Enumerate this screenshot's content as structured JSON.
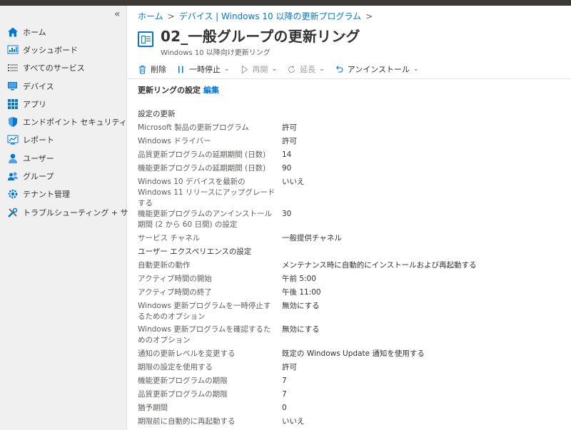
{
  "sidebar": {
    "collapse_glyph": "«",
    "items": [
      {
        "label": "ホーム",
        "icon": "home-icon"
      },
      {
        "label": "ダッシュボード",
        "icon": "dashboard-icon"
      },
      {
        "label": "すべてのサービス",
        "icon": "list-icon"
      },
      {
        "label": "デバイス",
        "icon": "devices-icon"
      },
      {
        "label": "アプリ",
        "icon": "apps-icon"
      },
      {
        "label": "エンドポイント セキュリティ",
        "icon": "shield-icon"
      },
      {
        "label": "レポート",
        "icon": "reports-icon"
      },
      {
        "label": "ユーザー",
        "icon": "user-icon"
      },
      {
        "label": "グループ",
        "icon": "group-icon"
      },
      {
        "label": "テナント管理",
        "icon": "tenant-gear-icon"
      },
      {
        "label": "トラブルシューティング + サポート",
        "icon": "wrench-icon"
      }
    ]
  },
  "breadcrumb": {
    "home": "ホーム",
    "devices": "デバイス | Windows 10 以降の更新プログラム"
  },
  "header": {
    "title": "02_一般グループの更新リング",
    "subtitle": "Windows 10 以降向け更新リング",
    "more": "···"
  },
  "toolbar": {
    "delete": "削除",
    "pause": "一時停止",
    "resume": "再開",
    "extend": "延長",
    "uninstall": "アンインストール"
  },
  "section": {
    "title": "更新リングの設定",
    "edit": "編集"
  },
  "settings": [
    {
      "k": "設定の更新",
      "v": "",
      "group": true
    },
    {
      "k": "Microsoft 製品の更新プログラム",
      "v": "許可"
    },
    {
      "k": "Windows ドライバー",
      "v": "許可"
    },
    {
      "k": "品質更新プログラムの延期期間 (日数)",
      "v": "14"
    },
    {
      "k": "機能更新プログラムの延期期間 (日数)",
      "v": "90"
    },
    {
      "k": "Windows 10 デバイスを最新の Windows 11 リリースにアップグレードする",
      "v": "いいえ"
    },
    {
      "k": "機能更新プログラムのアンインストール期間 (2 から 60 日間) の設定",
      "v": "30"
    },
    {
      "k": "サービス チャネル",
      "v": "一般提供チャネル"
    },
    {
      "k": "ユーザー エクスペリエンスの設定",
      "v": "",
      "group": true
    },
    {
      "k": "自動更新の動作",
      "v": "メンテナンス時に自動的にインストールおよび再起動する"
    },
    {
      "k": "アクティブ時間の開始",
      "v": "午前 5:00"
    },
    {
      "k": "アクティブ時間の終了",
      "v": "午後 11:00"
    },
    {
      "k": "Windows 更新プログラムを一時停止するためのオプション",
      "v": "無効にする"
    },
    {
      "k": "Windows 更新プログラムを確認するためのオプション",
      "v": "無効にする"
    },
    {
      "k": "通知の更新レベルを変更する",
      "v": "既定の Windows Update 通知を使用する"
    },
    {
      "k": "期限の設定を使用する",
      "v": "許可"
    },
    {
      "k": "機能更新プログラムの期限",
      "v": "7"
    },
    {
      "k": "品質更新プログラムの期限",
      "v": "7"
    },
    {
      "k": "猶予期間",
      "v": "0"
    },
    {
      "k": "期限前に自動的に再起動する",
      "v": "いいえ"
    }
  ]
}
